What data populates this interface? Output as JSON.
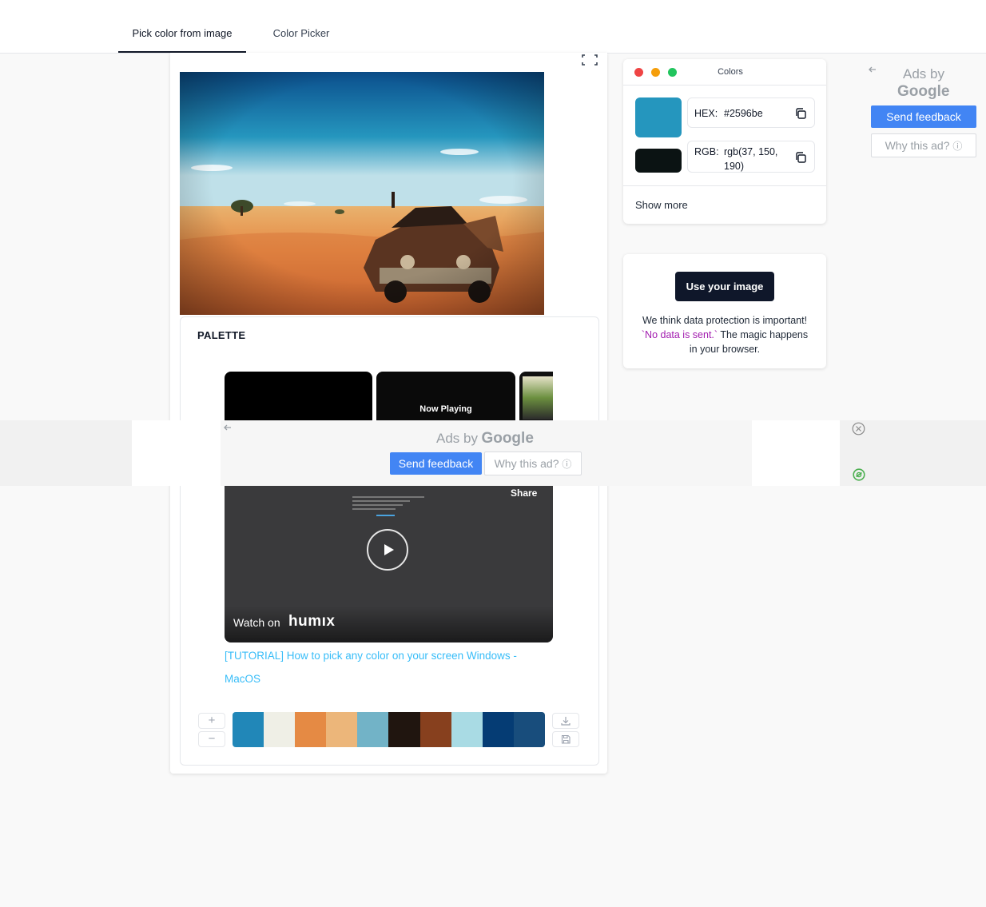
{
  "tabs": [
    {
      "label": "Pick color from image",
      "active": true
    },
    {
      "label": "Color Picker",
      "active": false
    }
  ],
  "palette_section": {
    "title": "PALETTE"
  },
  "colors_panel": {
    "title": "Colors",
    "primary_color": "#2596be",
    "secondary_color": "#0b1313",
    "hex_label": "HEX:",
    "hex_value": "#2596be",
    "rgb_label": "RGB:",
    "rgb_value_line1": "rgb(37, 150,",
    "rgb_value_line2": "190)",
    "show_more": "Show more"
  },
  "info_panel": {
    "button_label": "Use your image",
    "text_before": "We think data protection is important!",
    "text_highlight": "`No data is sent.`",
    "text_after": "The magic happens in your browser."
  },
  "side_ad": {
    "ads_by": "Ads by",
    "google": "Google",
    "send_feedback": "Send feedback",
    "why_this_ad": "Why this ad?"
  },
  "overlay_ad": {
    "ads_by": "Ads by",
    "google": "Google",
    "send_feedback": "Send feedback",
    "why_this_ad": "Why this ad?"
  },
  "video": {
    "now_playing": "Now Playing",
    "share": "Share",
    "watch_on": "Watch on",
    "brand": "humıx",
    "link_text": "[TUTORIAL] How to pick any color on your screen Windows - MacOS"
  },
  "palette_colors": [
    "#2187b8",
    "#efefe6",
    "#e58a44",
    "#ecb67a",
    "#72b3c7",
    "#20150f",
    "#87401e",
    "#a9dbe4",
    "#053c74",
    "#184d7c"
  ],
  "palette_controls": {
    "add": "+",
    "remove": "−"
  }
}
